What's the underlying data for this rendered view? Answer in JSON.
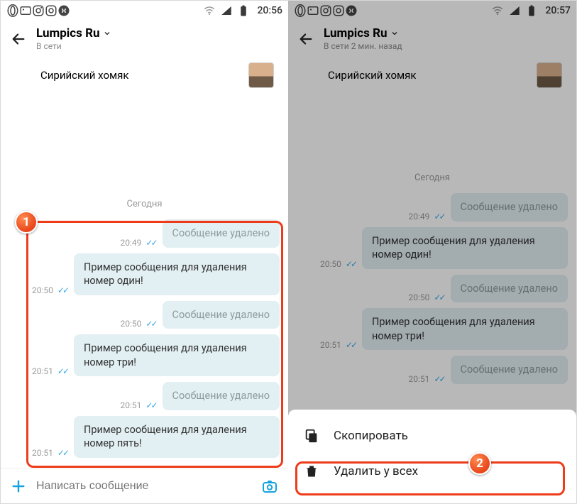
{
  "left": {
    "status": {
      "time": "20:56",
      "icons": [
        "opera",
        "art",
        "instagram",
        "outline-instagram",
        "shazam",
        "wifi",
        "signal",
        "battery"
      ]
    },
    "header": {
      "title": "Lumpics Ru",
      "status": "В сети"
    },
    "pinned": {
      "text": "Сирийский хомяк"
    },
    "today_label": "Сегодня",
    "messages": [
      {
        "time": "20:49",
        "text": "Сообщение удалено",
        "deleted": true
      },
      {
        "time": "20:50",
        "text": "Пример сообщения для удаления номер один!",
        "deleted": false
      },
      {
        "time": "20:50",
        "text": "Сообщение удалено",
        "deleted": true
      },
      {
        "time": "20:51",
        "text": "Пример сообщения для удаления номер три!",
        "deleted": false
      },
      {
        "time": "20:51",
        "text": "Сообщение удалено",
        "deleted": true
      },
      {
        "time": "20:51",
        "text": "Пример сообщения для удаления номер пять!",
        "deleted": false
      }
    ],
    "composer_placeholder": "Написать сообщение",
    "badge": "1"
  },
  "right": {
    "status": {
      "time": "20:57",
      "icons": [
        "opera",
        "art",
        "instagram",
        "outline-instagram",
        "shazam",
        "wifi",
        "signal",
        "battery"
      ]
    },
    "header": {
      "title": "Lumpics Ru",
      "status": "В сети 2 мин. назад"
    },
    "pinned": {
      "text": "Сирийский хомяк"
    },
    "today_label": "Сегодня",
    "messages": [
      {
        "time": "20:49",
        "text": "Сообщение удалено",
        "deleted": true
      },
      {
        "time": "20:50",
        "text": "Пример сообщения для удаления номер один!",
        "deleted": false
      },
      {
        "time": "20:50",
        "text": "Сообщение удалено",
        "deleted": true
      },
      {
        "time": "20:51",
        "text": "Пример сообщения для удаления номер три!",
        "deleted": false
      },
      {
        "time": "20:51",
        "text": "Сообщение удалено",
        "deleted": true
      }
    ],
    "sheet": {
      "copy": "Скопировать",
      "delete": "Удалить у всех"
    },
    "badge": "2"
  },
  "ticks_glyph": "✓✓"
}
